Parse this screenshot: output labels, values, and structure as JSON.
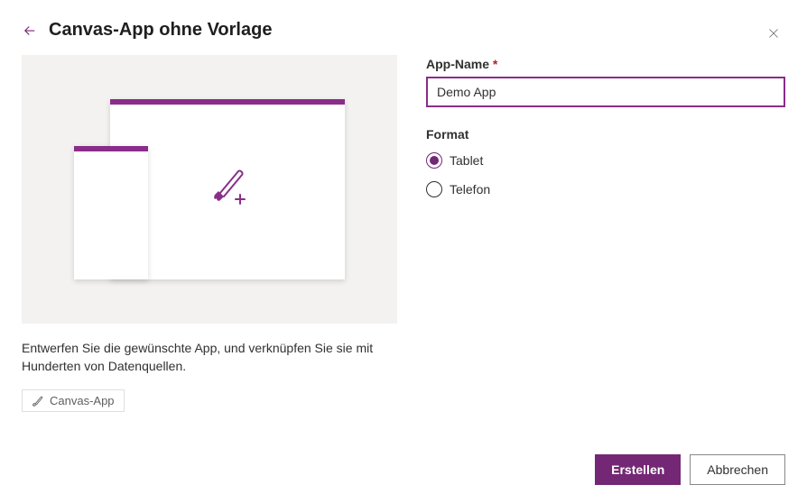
{
  "header": {
    "title": "Canvas-App ohne Vorlage"
  },
  "form": {
    "app_name_label": "App-Name",
    "app_name_value": "Demo App",
    "format_label": "Format",
    "options": {
      "tablet": "Tablet",
      "telefon": "Telefon"
    },
    "selected": "tablet"
  },
  "description": "Entwerfen Sie die gewünschte App, und verknüpfen Sie sie mit Hunderten von Datenquellen.",
  "tag": "Canvas-App",
  "footer": {
    "create": "Erstellen",
    "cancel": "Abbrechen"
  }
}
